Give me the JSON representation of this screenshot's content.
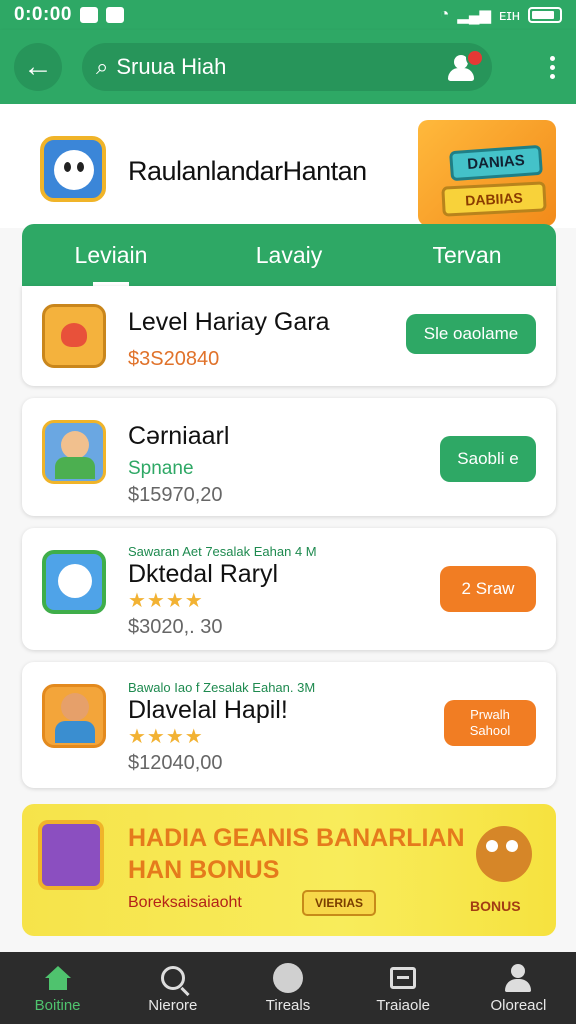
{
  "status_bar": {
    "time": "0:0:00",
    "network": "4G",
    "carrier": "ᴇɪʜ"
  },
  "header": {
    "back_icon": "arrow-left-icon",
    "search_placeholder": "Sruua Hiah",
    "notification_icon": "user-icon",
    "menu_icon": "more-vert-icon"
  },
  "hero": {
    "title": "RaulanlandarHantan",
    "art_line1": "DANIAS",
    "art_line2": "DABIIAS"
  },
  "tabs": [
    {
      "label": "Leviain"
    },
    {
      "label": "Lavaiy"
    },
    {
      "label": "Tervan"
    }
  ],
  "cards": [
    {
      "title": "Level Hariay Gara",
      "price": "$3S20840",
      "cta": "Sle oaolame",
      "cta_color": "#2ea865"
    },
    {
      "title": "Cərniaarl",
      "sub": "Spnane",
      "price": "$15970,20",
      "cta": "Saobli e",
      "cta_color": "#2ea865"
    },
    {
      "tag": "Sawaran Aet 7esalak Eahan 4 M",
      "title": "Dktedal Raryl",
      "rating": "★★★★",
      "price": "$3020,. 30",
      "cta": "2 Sraw",
      "cta_color": "#f17d23"
    },
    {
      "tag": "Bawalo Iao f Zesalak Eahan. 3M",
      "title": "Dlavelal Hapil!",
      "rating": "★★★★",
      "price": "$12040,00",
      "cta": "Prwalh Sahool",
      "cta_color": "#f17d23"
    }
  ],
  "banner": {
    "line1": "HADIA GEANIS BANARLIAN",
    "line2": "HAN BONUS",
    "promo": "Boreksaisaiaoht",
    "badge": "VIERIAS",
    "bonus_label": "BONUS"
  },
  "bottom_nav": [
    {
      "label": "Boitine",
      "icon": "home-icon",
      "active": true
    },
    {
      "label": "Nierore",
      "icon": "search-icon",
      "active": false
    },
    {
      "label": "Tireals",
      "icon": "circle-icon",
      "active": false
    },
    {
      "label": "Traiaole",
      "icon": "inbox-icon",
      "active": false
    },
    {
      "label": "Oloreacl",
      "icon": "account-icon",
      "active": false
    }
  ],
  "colors": {
    "primary": "#2ea865",
    "orange": "#f17d23",
    "dark_nav": "#2c2c2c"
  }
}
